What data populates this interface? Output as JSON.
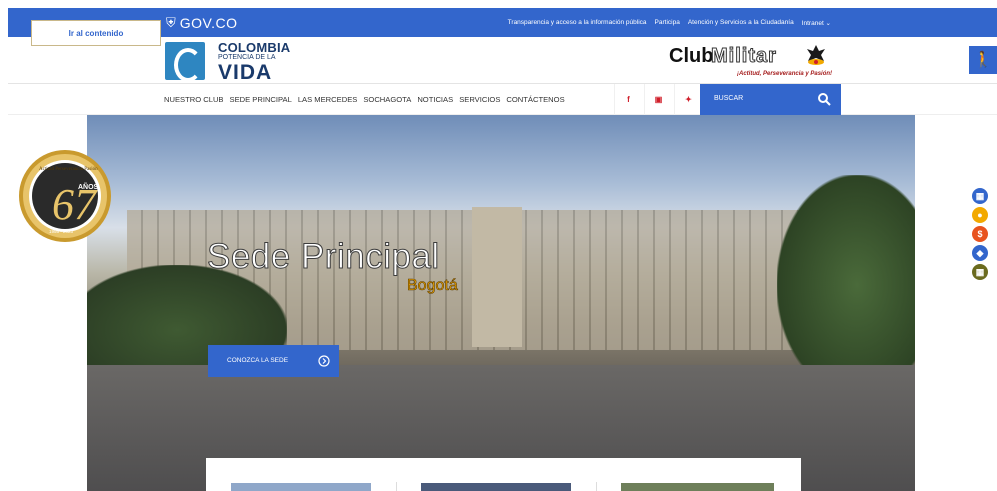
{
  "gov_bar": {
    "logo_text": "GOV.CO",
    "links": [
      "Transparencia y acceso a la información pública",
      "Participa",
      "Atención y Servicios a la Ciudadanía",
      "Intranet ⌄"
    ],
    "color": "#3366cc"
  },
  "skip_link": "Ir al contenido",
  "colombia_logo": {
    "line1": "COLOMBIA",
    "line2": "POTENCIA DE LA",
    "line3": "VIDA"
  },
  "club_logo": {
    "word1": "Club",
    "word2": "Militar",
    "slogan": "¡Actitud, Perseverancia y Pasión!"
  },
  "accessibility_icon": "accessibility-icon",
  "nav": {
    "items": [
      "NUESTRO CLUB",
      "SEDE PRINCIPAL",
      "LAS MERCEDES",
      "SOCHAGOTA",
      "NOTICIAS",
      "SERVICIOS",
      "CONTÁCTENOS"
    ],
    "social": [
      "f",
      "▣",
      "✦"
    ],
    "search_label": "BUSCAR"
  },
  "hero": {
    "title": "Sede Principal",
    "subtitle": "Bogotá",
    "cta": "CONOZCA LA SEDE"
  },
  "anniversary_badge": {
    "number": "67",
    "label": "AÑOS",
    "motto": "Actitud Perseverancia Pasión",
    "years": "1956 - 2023"
  },
  "side_icons": [
    {
      "name": "calendar-icon",
      "color": "#3366cc",
      "glyph": "▦"
    },
    {
      "name": "user-icon",
      "color": "#f2a900",
      "glyph": "●"
    },
    {
      "name": "dollar-icon",
      "color": "#e8531f",
      "glyph": "$"
    },
    {
      "name": "leaf-icon",
      "color": "#3366cc",
      "glyph": "◆"
    },
    {
      "name": "grid-icon",
      "color": "#6b6b1f",
      "glyph": "▦"
    }
  ]
}
